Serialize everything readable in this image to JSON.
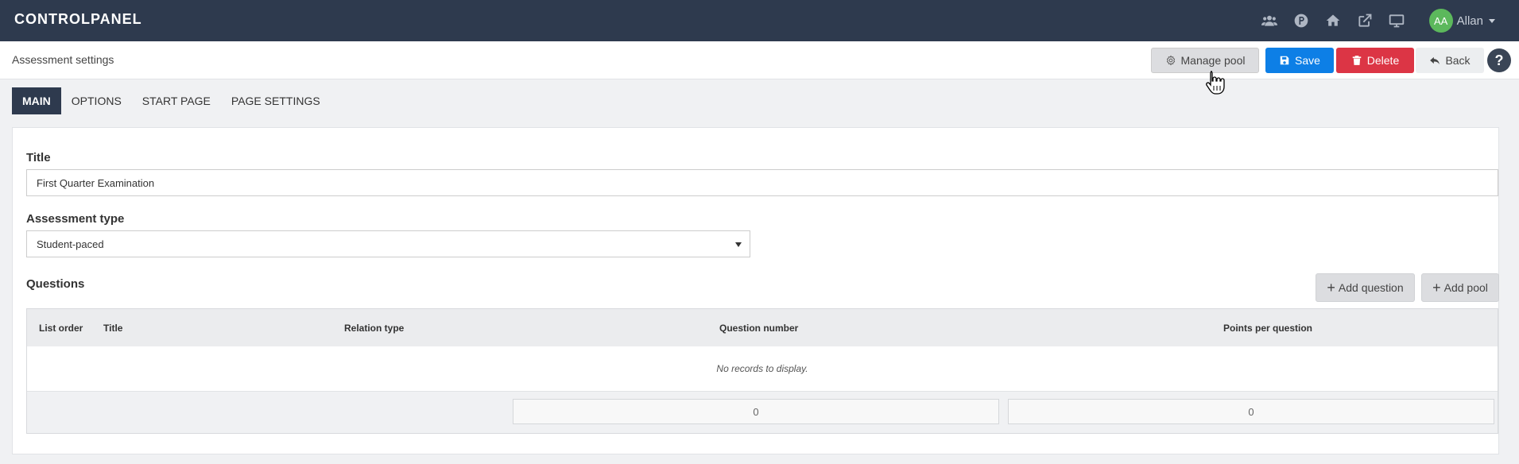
{
  "header": {
    "brand": "CONTROLPANEL",
    "icons": [
      "users-icon",
      "parking-icon",
      "home-icon",
      "external-link-icon",
      "monitor-icon"
    ],
    "user": {
      "initials": "AA",
      "name": "Allan",
      "avatar_color": "#5cb85c"
    }
  },
  "toolbar": {
    "page_title": "Assessment settings",
    "manage_pool_label": "Manage pool",
    "save_label": "Save",
    "delete_label": "Delete",
    "back_label": "Back",
    "help_label": "?"
  },
  "tabs": [
    {
      "label": "MAIN",
      "active": true
    },
    {
      "label": "OPTIONS",
      "active": false
    },
    {
      "label": "START PAGE",
      "active": false
    },
    {
      "label": "PAGE SETTINGS",
      "active": false
    }
  ],
  "form": {
    "title_label": "Title",
    "title_value": "First Quarter Examination",
    "assessment_type_label": "Assessment type",
    "assessment_type_value": "Student-paced",
    "questions_label": "Questions",
    "add_question_label": "Add question",
    "add_pool_label": "Add pool"
  },
  "grid": {
    "columns": [
      "List order",
      "Title",
      "Relation type",
      "Question number",
      "Points per question"
    ],
    "empty_text": "No records to display.",
    "totals": {
      "question_number": "0",
      "points_per_question": "0"
    }
  },
  "colors": {
    "topbar": "#2e3a4e",
    "save": "#0d7fe6",
    "delete": "#dc3545",
    "active_tab": "#2e3a4e"
  }
}
